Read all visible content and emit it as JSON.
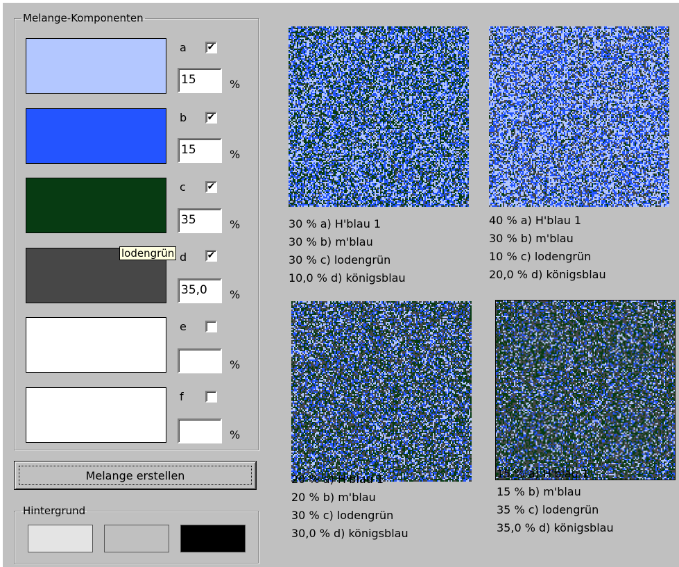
{
  "window": {
    "background": "#c0c0c0"
  },
  "melange_group": {
    "title": "Melange-Komponenten"
  },
  "components": [
    {
      "letter": "a",
      "checked": true,
      "percent": "15",
      "color": "#b3c7ff",
      "pct_sign": "%"
    },
    {
      "letter": "b",
      "checked": true,
      "percent": "15",
      "color": "#2454ff",
      "pct_sign": "%"
    },
    {
      "letter": "c",
      "checked": true,
      "percent": "35",
      "color": "#073b12",
      "pct_sign": "%"
    },
    {
      "letter": "d",
      "checked": true,
      "percent": "35,0",
      "color": "#474747",
      "pct_sign": "%"
    },
    {
      "letter": "e",
      "checked": false,
      "percent": "",
      "color": "#ffffff",
      "pct_sign": "%"
    },
    {
      "letter": "f",
      "checked": false,
      "percent": "",
      "color": "#ffffff",
      "pct_sign": "%"
    }
  ],
  "tooltip": {
    "text": "lodengrün"
  },
  "create_button": {
    "label": "Melange erstellen"
  },
  "background_group": {
    "title": "Hintergrund",
    "swatches": [
      "#e4e4e4",
      "#c0c0c0",
      "#000000"
    ]
  },
  "previews": [
    {
      "lines": [
        "30 % a)  H'blau 1",
        "30 % b)  m'blau",
        "30 % c)  lodengrün",
        "10,0 % d)  königsblau"
      ],
      "weights": [
        30,
        30,
        30,
        10
      ],
      "colors": [
        "#b3c7ff",
        "#2454ff",
        "#073b12",
        "#474747"
      ]
    },
    {
      "lines": [
        "40 % a)  H'blau 1",
        "30 % b)  m'blau",
        "10 % c)  lodengrün",
        "20,0 % d)  königsblau"
      ],
      "weights": [
        40,
        30,
        10,
        20
      ],
      "colors": [
        "#b3c7ff",
        "#2454ff",
        "#073b12",
        "#474747"
      ]
    },
    {
      "lines": [
        "20 % a)  H'blau 1",
        "20 % b)  m'blau",
        "30 % c)  lodengrün",
        "30,0 % d)  königsblau"
      ],
      "weights": [
        20,
        20,
        30,
        30
      ],
      "colors": [
        "#b3c7ff",
        "#2454ff",
        "#073b12",
        "#474747"
      ]
    },
    {
      "lines": [
        "15 % a)  H'blau 1",
        "15 % b)  m'blau",
        "35 % c)  lodengrün",
        "35,0 % d)  königsblau"
      ],
      "weights": [
        15,
        15,
        35,
        35
      ],
      "colors": [
        "#b3c7ff",
        "#2454ff",
        "#073b12",
        "#474747"
      ]
    }
  ]
}
